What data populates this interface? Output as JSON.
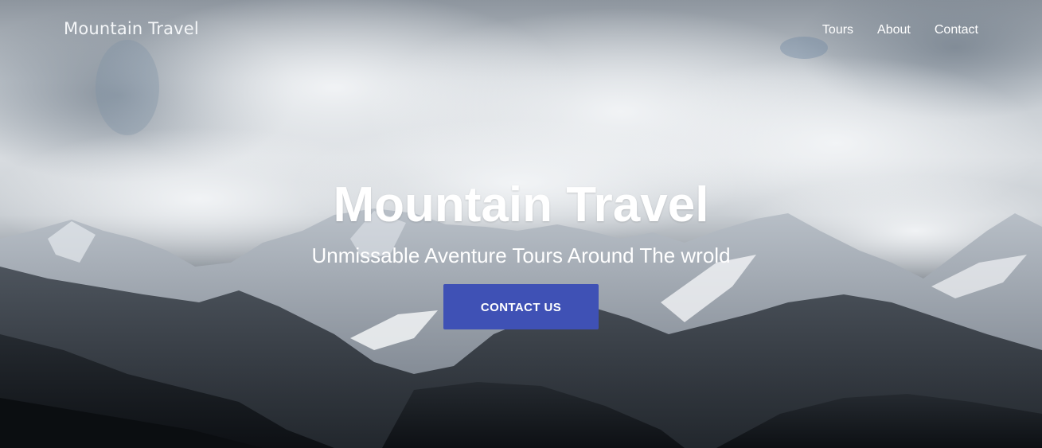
{
  "navbar": {
    "brand": "Mountain Travel",
    "links": [
      {
        "label": "Tours"
      },
      {
        "label": "About"
      },
      {
        "label": "Contact"
      }
    ]
  },
  "hero": {
    "title": "Mountain Travel",
    "subtitle": "Unmissable Aventure Tours Around The wrold",
    "cta_label": "CONTACT US",
    "colors": {
      "cta_background": "#3f51b5",
      "text": "#ffffff"
    },
    "background_image": "cloudy-sky-over-snowy-mountain-range"
  }
}
